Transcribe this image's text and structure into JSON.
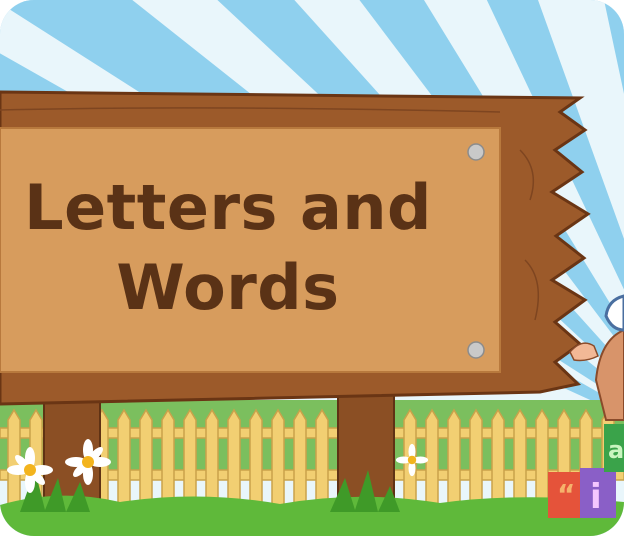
{
  "sign": {
    "title_line_1": "Letters and",
    "title_line_2": "Words"
  },
  "blocks": {
    "block_quote_glyph": "“",
    "block_i_glyph": "i",
    "block_a_glyph": "a"
  },
  "icons": [
    "sign-board",
    "picket-fence",
    "daisy-flower-icon",
    "cartoon-character",
    "letter-blocks",
    "sun-rays"
  ],
  "colors": {
    "sky_light": "#e9f6fb",
    "sky_ray": "#8fd0ee",
    "board_face": "#d79c5d",
    "board_frame": "#9c5a2a",
    "title_text": "#5a3216",
    "fence": "#f2cf72",
    "grass": "#5fb93a"
  }
}
